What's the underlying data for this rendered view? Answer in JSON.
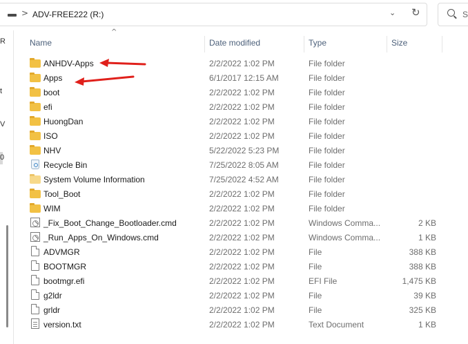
{
  "address_bar": {
    "path": "ADV-FREE222 (R:)",
    "separator": ">",
    "dropdown_glyph": "⌄",
    "refresh_glyph": "↻"
  },
  "search": {
    "placeholder": "S"
  },
  "nav_pane": {
    "visible_fragments": [
      {
        "text": "R"
      },
      {
        "text": "t"
      },
      {
        "text": "V"
      },
      {
        "text": "0"
      }
    ]
  },
  "columns": {
    "name": "Name",
    "date": "Date modified",
    "type": "Type",
    "size": "Size",
    "sort_glyph": "^"
  },
  "files": [
    {
      "name": "ANHDV-Apps",
      "date": "2/2/2022 1:02 PM",
      "type": "File folder",
      "size": "",
      "icon": "folder-icon"
    },
    {
      "name": "Apps",
      "date": "6/1/2017 12:15 AM",
      "type": "File folder",
      "size": "",
      "icon": "folder-icon"
    },
    {
      "name": "boot",
      "date": "2/2/2022 1:02 PM",
      "type": "File folder",
      "size": "",
      "icon": "folder-icon"
    },
    {
      "name": "efi",
      "date": "2/2/2022 1:02 PM",
      "type": "File folder",
      "size": "",
      "icon": "folder-icon"
    },
    {
      "name": "HuongDan",
      "date": "2/2/2022 1:02 PM",
      "type": "File folder",
      "size": "",
      "icon": "folder-icon"
    },
    {
      "name": "ISO",
      "date": "2/2/2022 1:02 PM",
      "type": "File folder",
      "size": "",
      "icon": "folder-icon"
    },
    {
      "name": "NHV",
      "date": "5/22/2022 5:23 PM",
      "type": "File folder",
      "size": "",
      "icon": "folder-icon"
    },
    {
      "name": "Recycle Bin",
      "date": "7/25/2022 8:05 AM",
      "type": "File folder",
      "size": "",
      "icon": "recycle-bin-icon"
    },
    {
      "name": "System Volume Information",
      "date": "7/25/2022 4:52 AM",
      "type": "File folder",
      "size": "",
      "icon": "folder-light-icon"
    },
    {
      "name": "Tool_Boot",
      "date": "2/2/2022 1:02 PM",
      "type": "File folder",
      "size": "",
      "icon": "folder-icon"
    },
    {
      "name": "WIM",
      "date": "2/2/2022 1:02 PM",
      "type": "File folder",
      "size": "",
      "icon": "folder-icon"
    },
    {
      "name": "_Fix_Boot_Change_Bootloader.cmd",
      "date": "2/2/2022 1:02 PM",
      "type": "Windows Comma...",
      "size": "2 KB",
      "icon": "cmd-file-icon"
    },
    {
      "name": "_Run_Apps_On_Windows.cmd",
      "date": "2/2/2022 1:02 PM",
      "type": "Windows Comma...",
      "size": "1 KB",
      "icon": "cmd-file-icon"
    },
    {
      "name": "ADVMGR",
      "date": "2/2/2022 1:02 PM",
      "type": "File",
      "size": "388 KB",
      "icon": "file-icon"
    },
    {
      "name": "BOOTMGR",
      "date": "2/2/2022 1:02 PM",
      "type": "File",
      "size": "388 KB",
      "icon": "file-icon"
    },
    {
      "name": "bootmgr.efi",
      "date": "2/2/2022 1:02 PM",
      "type": "EFI File",
      "size": "1,475 KB",
      "icon": "file-icon"
    },
    {
      "name": "g2ldr",
      "date": "2/2/2022 1:02 PM",
      "type": "File",
      "size": "39 KB",
      "icon": "file-icon"
    },
    {
      "name": "grldr",
      "date": "2/2/2022 1:02 PM",
      "type": "File",
      "size": "325 KB",
      "icon": "file-icon"
    },
    {
      "name": "version.txt",
      "date": "2/2/2022 1:02 PM",
      "type": "Text Document",
      "size": "1 KB",
      "icon": "text-file-icon"
    }
  ],
  "annotations": {
    "arrow_color": "#e0201b"
  },
  "colors": {
    "folder": "#f2c144",
    "header_text": "#4c607a",
    "secondary_text": "#6d6d6d"
  }
}
